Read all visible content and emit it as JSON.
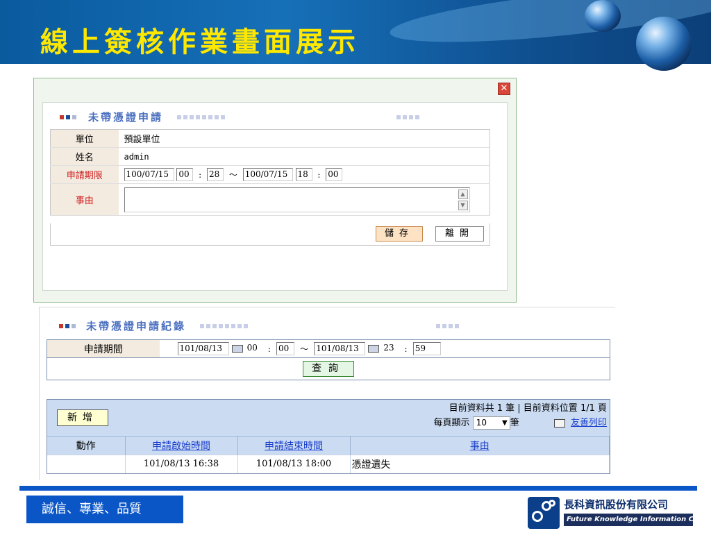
{
  "slide": {
    "title": "線上簽核作業畫面展示",
    "motto": "誠信、專業、品質",
    "company_name": "長科資訊股份有限公司",
    "company_name_en": "Future Knowledge Information Co."
  },
  "dialog": {
    "close_icon": "close-x",
    "section_title": "未帶憑證申請",
    "fields": {
      "unit_label": "單位",
      "unit_value": "預設單位",
      "name_label": "姓名",
      "name_value": "admin",
      "period_label": "申請期限",
      "start_date": "100/07/15",
      "start_hour": "00",
      "start_minute": "28",
      "range_sep": "～",
      "end_date": "100/07/15",
      "end_hour": "18",
      "end_minute": "00",
      "reason_label": "事由",
      "reason_value": ""
    },
    "save_label": "儲存",
    "leave_label": "離開"
  },
  "records": {
    "section_title": "未帶憑證申請紀錄",
    "query": {
      "label": "申請期間",
      "start_date": "101/08/13",
      "start_hour": "00",
      "start_minute": "00",
      "range_sep": "～",
      "end_date": "101/08/13",
      "end_hour": "23",
      "end_minute": "59",
      "button": "查詢"
    },
    "add_button": "新增",
    "info_line": "目前資料共 1 筆 | 目前資料位置 1/1 頁",
    "page_size_label": "每頁顯示",
    "page_size_value": "10",
    "page_size_unit": "筆",
    "print_link": "友善列印",
    "columns": [
      "動作",
      "申請啟始時間",
      "申請結束時間",
      "事由"
    ],
    "rows": [
      {
        "action": "",
        "start": "101/08/13 16:38",
        "end": "101/08/13 18:00",
        "reason": "憑證遺失"
      }
    ]
  }
}
